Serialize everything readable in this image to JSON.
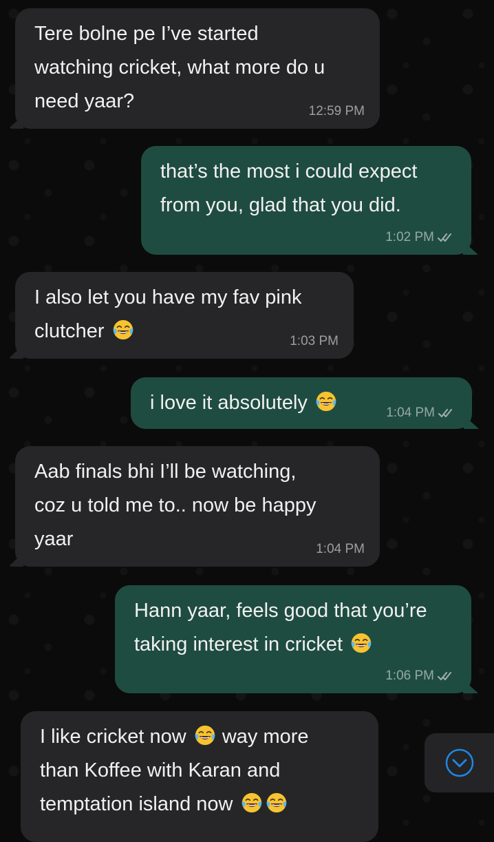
{
  "messages": [
    {
      "direction": "incoming",
      "text_parts": [
        "Tere bolne pe I’ve started",
        "watching cricket, what more do u",
        "need yaar?"
      ],
      "time": "12:59 PM"
    },
    {
      "direction": "outgoing",
      "text_parts": [
        "that’s the most i could expect",
        "from you, glad that you did."
      ],
      "time": "1:02 PM"
    },
    {
      "direction": "incoming",
      "text_parts": [
        "I also let you have my fav pink",
        "clutcher"
      ],
      "time": "1:03 PM"
    },
    {
      "direction": "outgoing",
      "text_parts": [
        "i love it absolutely"
      ],
      "time": "1:04 PM"
    },
    {
      "direction": "incoming",
      "text_parts": [
        "Aab finals bhi I’ll be watching,",
        "coz u told me to.. now be happy",
        "yaar"
      ],
      "time": "1:04 PM"
    },
    {
      "direction": "outgoing",
      "text_parts": [
        "Hann yaar, feels good that you’re",
        "taking interest in cricket"
      ],
      "time": "1:06 PM"
    },
    {
      "direction": "incoming",
      "text_parts": [
        "I like cricket now",
        "way more",
        "than Koffee with Karan and",
        "temptation island now"
      ],
      "time": ""
    }
  ],
  "emoji": "laughing-tears-emoji",
  "icons": {
    "read_receipt": "double-check-icon",
    "scroll_down": "chevron-down-circle-icon"
  },
  "colors": {
    "incoming_bubble": "#262628",
    "outgoing_bubble": "#1f4c40",
    "background": "#0b0b0b",
    "accent": "#1e88e5"
  }
}
